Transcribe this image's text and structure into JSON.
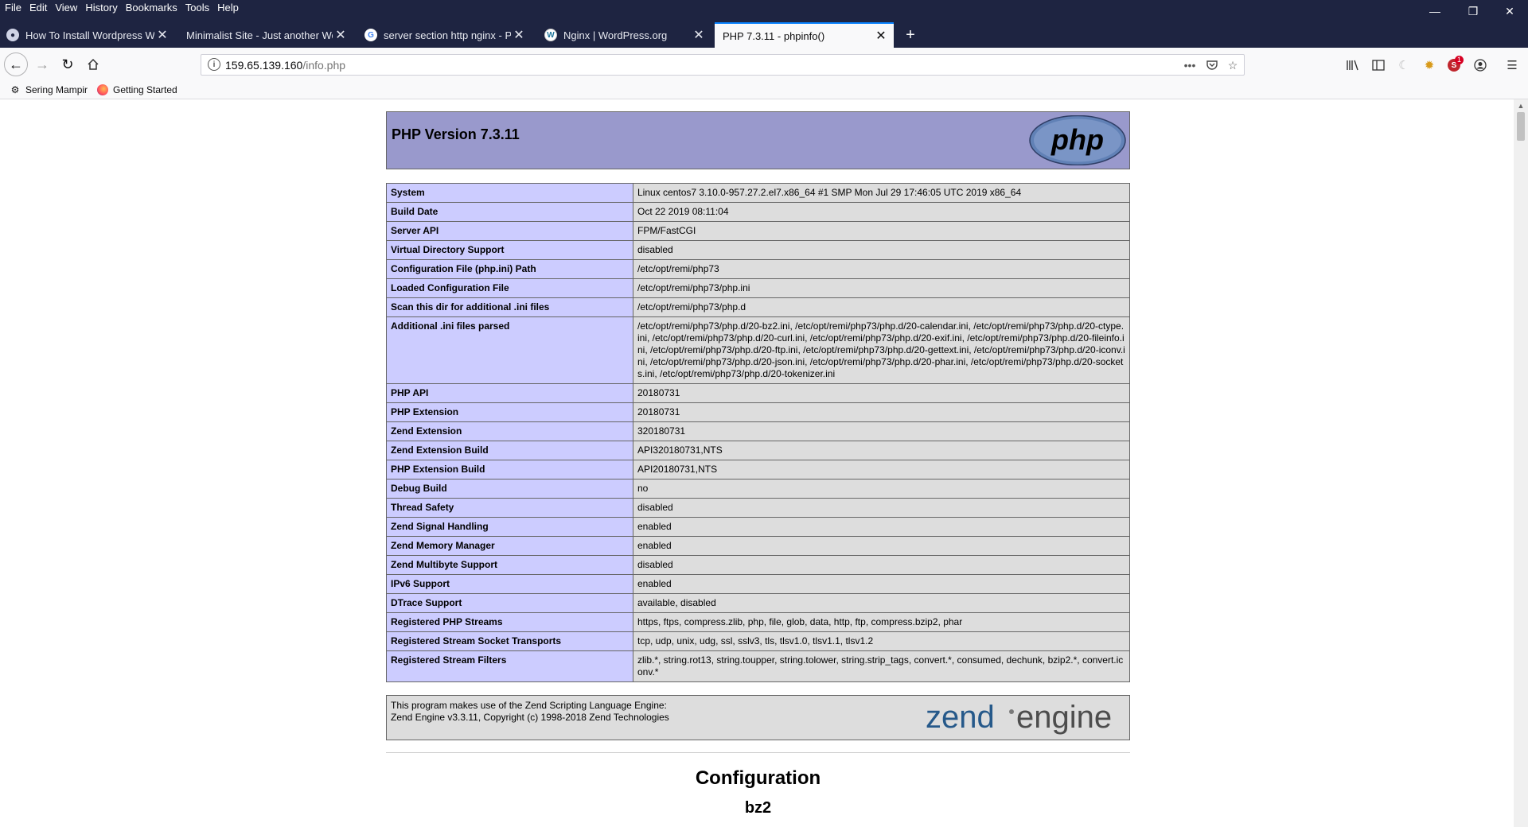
{
  "menu": [
    "File",
    "Edit",
    "View",
    "History",
    "Bookmarks",
    "Tools",
    "Help"
  ],
  "window_controls": {
    "minimize": "—",
    "maximize": "❐",
    "close": "✕"
  },
  "tabs": [
    {
      "title": "How To Install Wordpress With",
      "active": false,
      "icon": "tab-favicon-icon"
    },
    {
      "title": "Minimalist Site - Just another Word",
      "active": false,
      "icon": "none"
    },
    {
      "title": "server section http nginx - Pen",
      "active": false,
      "icon": "google-icon"
    },
    {
      "title": "Nginx | WordPress.org",
      "active": false,
      "icon": "wordpress-icon"
    },
    {
      "title": "PHP 7.3.11 - phpinfo()",
      "active": true,
      "icon": "none"
    }
  ],
  "url": {
    "host": "159.65.139.160",
    "path": "/info.php"
  },
  "bookmarks": [
    {
      "label": "Sering Mampir",
      "icon": "gear-icon"
    },
    {
      "label": "Getting Started",
      "icon": "firefox-icon"
    }
  ],
  "toolbar_badge": "1",
  "page": {
    "header_title": "PHP Version 7.3.11",
    "logo_text": "php",
    "rows": [
      {
        "key": "System",
        "value": "Linux centos7 3.10.0-957.27.2.el7.x86_64 #1 SMP Mon Jul 29 17:46:05 UTC 2019 x86_64"
      },
      {
        "key": "Build Date",
        "value": "Oct 22 2019 08:11:04"
      },
      {
        "key": "Server API",
        "value": "FPM/FastCGI"
      },
      {
        "key": "Virtual Directory Support",
        "value": "disabled"
      },
      {
        "key": "Configuration File (php.ini) Path",
        "value": "/etc/opt/remi/php73"
      },
      {
        "key": "Loaded Configuration File",
        "value": "/etc/opt/remi/php73/php.ini"
      },
      {
        "key": "Scan this dir for additional .ini files",
        "value": "/etc/opt/remi/php73/php.d"
      },
      {
        "key": "Additional .ini files parsed",
        "value": "/etc/opt/remi/php73/php.d/20-bz2.ini, /etc/opt/remi/php73/php.d/20-calendar.ini, /etc/opt/remi/php73/php.d/20-ctype.ini, /etc/opt/remi/php73/php.d/20-curl.ini, /etc/opt/remi/php73/php.d/20-exif.ini, /etc/opt/remi/php73/php.d/20-fileinfo.ini, /etc/opt/remi/php73/php.d/20-ftp.ini, /etc/opt/remi/php73/php.d/20-gettext.ini, /etc/opt/remi/php73/php.d/20-iconv.ini, /etc/opt/remi/php73/php.d/20-json.ini, /etc/opt/remi/php73/php.d/20-phar.ini, /etc/opt/remi/php73/php.d/20-sockets.ini, /etc/opt/remi/php73/php.d/20-tokenizer.ini"
      },
      {
        "key": "PHP API",
        "value": "20180731"
      },
      {
        "key": "PHP Extension",
        "value": "20180731"
      },
      {
        "key": "Zend Extension",
        "value": "320180731"
      },
      {
        "key": "Zend Extension Build",
        "value": "API320180731,NTS"
      },
      {
        "key": "PHP Extension Build",
        "value": "API20180731,NTS"
      },
      {
        "key": "Debug Build",
        "value": "no"
      },
      {
        "key": "Thread Safety",
        "value": "disabled"
      },
      {
        "key": "Zend Signal Handling",
        "value": "enabled"
      },
      {
        "key": "Zend Memory Manager",
        "value": "enabled"
      },
      {
        "key": "Zend Multibyte Support",
        "value": "disabled"
      },
      {
        "key": "IPv6 Support",
        "value": "enabled"
      },
      {
        "key": "DTrace Support",
        "value": "available, disabled"
      },
      {
        "key": "Registered PHP Streams",
        "value": "https, ftps, compress.zlib, php, file, glob, data, http, ftp, compress.bzip2, phar"
      },
      {
        "key": "Registered Stream Socket Transports",
        "value": "tcp, udp, unix, udg, ssl, sslv3, tls, tlsv1.0, tlsv1.1, tlsv1.2"
      },
      {
        "key": "Registered Stream Filters",
        "value": "zlib.*, string.rot13, string.toupper, string.tolower, string.strip_tags, convert.*, consumed, dechunk, bzip2.*, convert.iconv.*"
      }
    ],
    "zend_line1": "This program makes use of the Zend Scripting Language Engine:",
    "zend_line2": "Zend Engine v3.3.11, Copyright (c) 1998-2018 Zend Technologies",
    "zend_logo_word1": "zend",
    "zend_logo_word2": "engine",
    "section_title": "Configuration",
    "subsection_title": "bz2"
  },
  "colors": {
    "chrome": "#1e2441",
    "php_header": "#9999cc",
    "key_cell": "#ccccff",
    "value_cell": "#dddddd"
  }
}
